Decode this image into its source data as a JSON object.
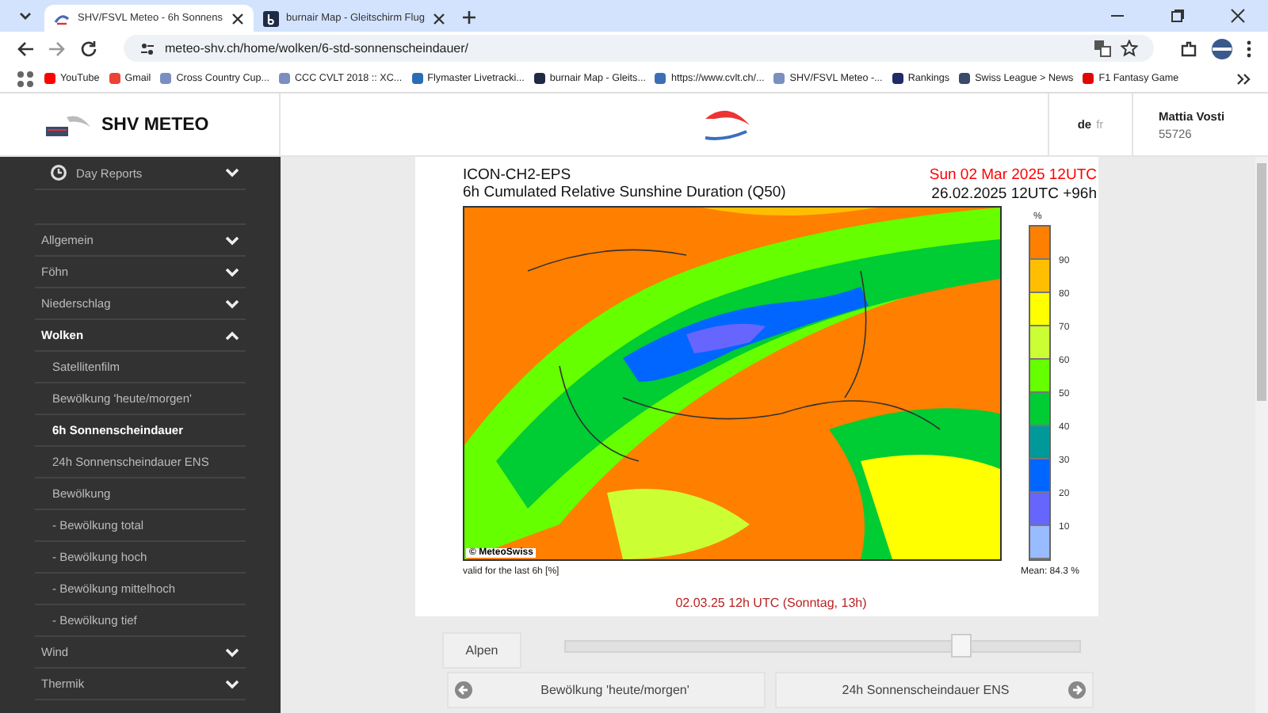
{
  "browser": {
    "tabs": [
      {
        "title": "SHV/FSVL Meteo - 6h Sonnens",
        "selected": true
      },
      {
        "title": "burnair Map - Gleitschirm Flug",
        "selected": false
      }
    ],
    "url": "meteo-shv.ch/home/wolken/6-std-sonnenscheindauer/",
    "bookmarks": [
      {
        "label": "YouTube",
        "color": "#ff0000"
      },
      {
        "label": "Gmail",
        "color": "#ea4335"
      },
      {
        "label": "Cross Country Cup...",
        "color": "#7a8fc0"
      },
      {
        "label": "CCC CVLT 2018 :: XC...",
        "color": "#7a8fc0"
      },
      {
        "label": "Flymaster Livetracki...",
        "color": "#2a6db5"
      },
      {
        "label": "burnair Map - Gleits...",
        "color": "#1f2a44"
      },
      {
        "label": "https://www.cvlt.ch/...",
        "color": "#3d6fb6"
      },
      {
        "label": "SHV/FSVL Meteo -...",
        "color": "#7a8fc0"
      },
      {
        "label": "Rankings",
        "color": "#1f2a66"
      },
      {
        "label": "Swiss League > News",
        "color": "#3b4a6b"
      },
      {
        "label": "F1 Fantasy Game",
        "color": "#e10600"
      }
    ]
  },
  "site": {
    "logo_text": "SHV METEO",
    "languages": [
      {
        "label": "de",
        "selected": true
      },
      {
        "label": "fr",
        "selected": false
      }
    ],
    "user": {
      "name": "Mattia Vosti",
      "number": "55726"
    }
  },
  "sidebar": {
    "day_reports": "Day Reports",
    "items": [
      {
        "label": "Allgemein",
        "expanded": false
      },
      {
        "label": "Föhn",
        "expanded": false
      },
      {
        "label": "Niederschlag",
        "expanded": false
      },
      {
        "label": "Wolken",
        "expanded": true,
        "children": [
          {
            "label": "Satellitenfilm",
            "selected": false
          },
          {
            "label": "Bewölkung 'heute/morgen'",
            "selected": false
          },
          {
            "label": "6h Sonnenscheindauer",
            "selected": true
          },
          {
            "label": "24h Sonnenscheindauer ENS",
            "selected": false
          },
          {
            "label": "Bewölkung",
            "selected": false
          },
          {
            "label": "- Bewölkung total",
            "selected": false
          },
          {
            "label": "- Bewölkung hoch",
            "selected": false
          },
          {
            "label": "- Bewölkung mittelhoch",
            "selected": false
          },
          {
            "label": "- Bewölkung tief",
            "selected": false
          }
        ]
      },
      {
        "label": "Wind",
        "expanded": false
      },
      {
        "label": "Thermik",
        "expanded": false
      }
    ]
  },
  "forecast": {
    "model": "ICON-CH2-EPS",
    "title": "6h Cumulated Relative Sunshine Duration (Q50)",
    "valid_date": "Sun 02 Mar 2025 12UTC",
    "run": "26.02.2025 12UTC +96h",
    "copyright": "© MeteoSwiss",
    "unit": "%",
    "legend": [
      {
        "color": "#ff7f00",
        "label": "90"
      },
      {
        "color": "#ffbf00",
        "label": "80"
      },
      {
        "color": "#ffff00",
        "label": "70"
      },
      {
        "color": "#ccff33",
        "label": "60"
      },
      {
        "color": "#66ff00",
        "label": "50"
      },
      {
        "color": "#00cc33",
        "label": "40"
      },
      {
        "color": "#009999",
        "label": "30"
      },
      {
        "color": "#0066ff",
        "label": "20"
      },
      {
        "color": "#6666ff",
        "label": "10"
      },
      {
        "color": "#99bbff"
      }
    ],
    "validity": "valid for the last 6h [%]",
    "mean": "Mean:  84.3 %"
  },
  "time_label": "02.03.25 12h UTC (Sonntag, 13h)",
  "time_slider": {
    "level": 0.77
  },
  "region_button": "Alpen",
  "nav": {
    "previous": "Bewölkung 'heute/morgen'",
    "next": "24h Sonnenscheindauer ENS"
  }
}
